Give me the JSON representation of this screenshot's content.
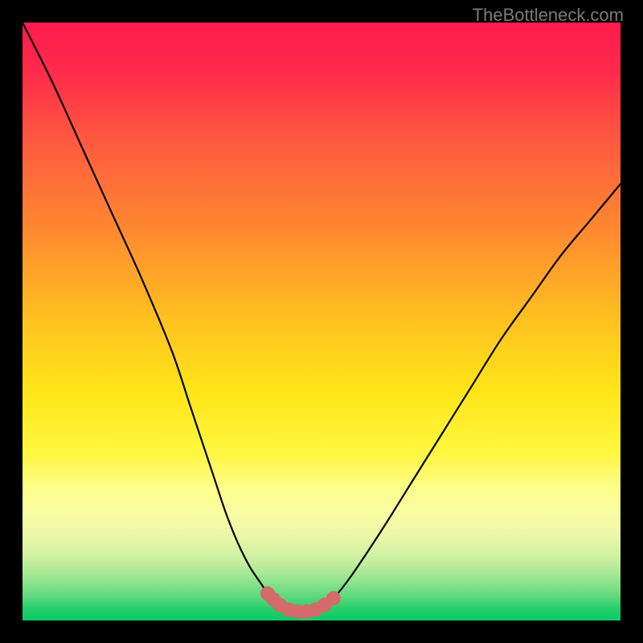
{
  "watermark": "TheBottleneck.com",
  "chart_data": {
    "type": "line",
    "title": "",
    "xlabel": "",
    "ylabel": "",
    "xlim": [
      0,
      100
    ],
    "ylim": [
      0,
      100
    ],
    "grid": false,
    "series": [
      {
        "name": "bottleneck-curve",
        "x": [
          0,
          5,
          10,
          15,
          20,
          25,
          28,
          30,
          32,
          34,
          36,
          38,
          40,
          41,
          42,
          43,
          44.5,
          46,
          47.5,
          49,
          50.5,
          52,
          55,
          60,
          65,
          70,
          75,
          80,
          85,
          90,
          95,
          100
        ],
        "values": [
          100,
          90,
          79,
          68,
          57,
          45,
          36,
          30,
          24,
          18,
          13,
          9,
          6,
          4.5,
          3.5,
          2.6,
          1.8,
          1.5,
          1.5,
          1.8,
          2.6,
          3.7,
          7.5,
          15,
          23,
          31,
          39,
          47,
          54,
          61,
          67,
          73
        ]
      }
    ],
    "markers": {
      "name": "highlight-dots",
      "color": "#d46a6a",
      "points": [
        {
          "x": 41,
          "y": 4.5
        },
        {
          "x": 42,
          "y": 3.5
        },
        {
          "x": 43,
          "y": 2.6
        },
        {
          "x": 44.5,
          "y": 1.8
        },
        {
          "x": 46,
          "y": 1.5
        },
        {
          "x": 47.5,
          "y": 1.5
        },
        {
          "x": 49,
          "y": 1.8
        },
        {
          "x": 50.5,
          "y": 2.6
        },
        {
          "x": 52,
          "y": 3.7
        }
      ]
    },
    "gradient_stops": [
      {
        "pos": 0,
        "color": "#ff1b4f"
      },
      {
        "pos": 50,
        "color": "#ffc21f"
      },
      {
        "pos": 78,
        "color": "#fdfd8c"
      },
      {
        "pos": 100,
        "color": "#0acb65"
      }
    ]
  }
}
